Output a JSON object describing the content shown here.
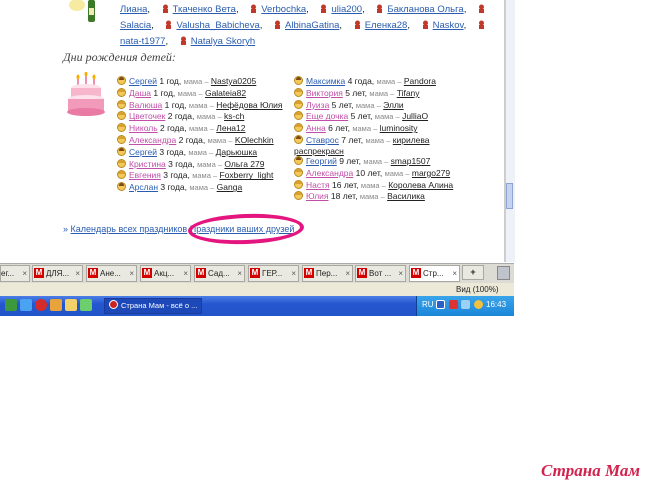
{
  "holiday_users": {
    "row1": [
      "Лиана",
      "Ткаченко Вета",
      "Verbochka",
      "ulia200",
      "Бакланова Ольга",
      "Salacia",
      "Valusha_Babicheva",
      "AlbinaGatina",
      "Еленка28",
      "Naskov",
      "nata-t1977",
      "Natalya Skoryh"
    ]
  },
  "section_title": "Дни рождения детей:",
  "mama_label": "мама –",
  "left_children": [
    {
      "name": "Сергей",
      "age": "1 год,",
      "mom": "Nastya0205",
      "gender": "b"
    },
    {
      "name": "Даша",
      "age": "1 год,",
      "mom": "Galateia82",
      "gender": "g"
    },
    {
      "name": "Валюша",
      "age": "1 год,",
      "mom": "Нефёдова Юлия",
      "gender": "g"
    },
    {
      "name": "Цветочек",
      "age": "2 года,",
      "mom": "ks-ch",
      "gender": "g"
    },
    {
      "name": "Николь",
      "age": "2 года,",
      "mom": "Лена12",
      "gender": "g"
    },
    {
      "name": "Александра",
      "age": "2 года,",
      "mom": "KOlechkin",
      "gender": "g"
    },
    {
      "name": "Сергей",
      "age": "3 года,",
      "mom": "Дарьюшка",
      "gender": "b"
    },
    {
      "name": "Кристина",
      "age": "3 года,",
      "mom": "Ольга 279",
      "gender": "g"
    },
    {
      "name": "Евгения",
      "age": "3 года,",
      "mom": "Foxberry_light",
      "gender": "g"
    },
    {
      "name": "Арслан",
      "age": "3 года,",
      "mom": "Ganga",
      "gender": "b"
    }
  ],
  "right_children": [
    {
      "name": "Максимка",
      "age": "4 года,",
      "mom": "Pandora",
      "gender": "b"
    },
    {
      "name": "Виктория",
      "age": "5 лет,",
      "mom": "Tifany",
      "gender": "g"
    },
    {
      "name": "Луиза",
      "age": "5 лет,",
      "mom": "Элли",
      "gender": "g"
    },
    {
      "name": "Еще дочка",
      "age": "5 лет,",
      "mom": "JulliaO",
      "gender": "g"
    },
    {
      "name": "Анна",
      "age": "6 лет,",
      "mom": "luminosity",
      "gender": "g"
    },
    {
      "name": "Ставрос",
      "age": "7 лет,",
      "mom": "кирилева распрекрасн",
      "gender": "b"
    },
    {
      "name": "Георгий",
      "age": "9 лет,",
      "mom": "smap1507",
      "gender": "b"
    },
    {
      "name": "Александра",
      "age": "10 лет,",
      "mom": "margo279",
      "gender": "g"
    },
    {
      "name": "Настя",
      "age": "16 лет,",
      "mom": "Королева Алина",
      "gender": "g"
    },
    {
      "name": "Юлия",
      "age": "18 лет,",
      "mom": "Василика",
      "gender": "g"
    }
  ],
  "bottom_links": {
    "calendar": "Календарь всех праздников",
    "friends": "Праздники ваших друзей"
  },
  "tabs": [
    {
      "label": "ег..."
    },
    {
      "label": "ДЛЯ..."
    },
    {
      "label": "Ане..."
    },
    {
      "label": "Акц..."
    },
    {
      "label": "Сад..."
    },
    {
      "label": "ГЕР..."
    },
    {
      "label": "Пер..."
    },
    {
      "label": "Вот ..."
    },
    {
      "label": "Стр..."
    }
  ],
  "new_tab_label": "+",
  "zoom_label": "Вид (100%)",
  "taskbar_task": "Страна Мам - всё о ...",
  "tray": {
    "lang": "RU",
    "time": "16:43"
  },
  "watermark": "Страна Мам",
  "colors": {
    "highlight_circle": "#e4157f",
    "link": "#2a5db0",
    "girl_link": "#c14ea8"
  }
}
